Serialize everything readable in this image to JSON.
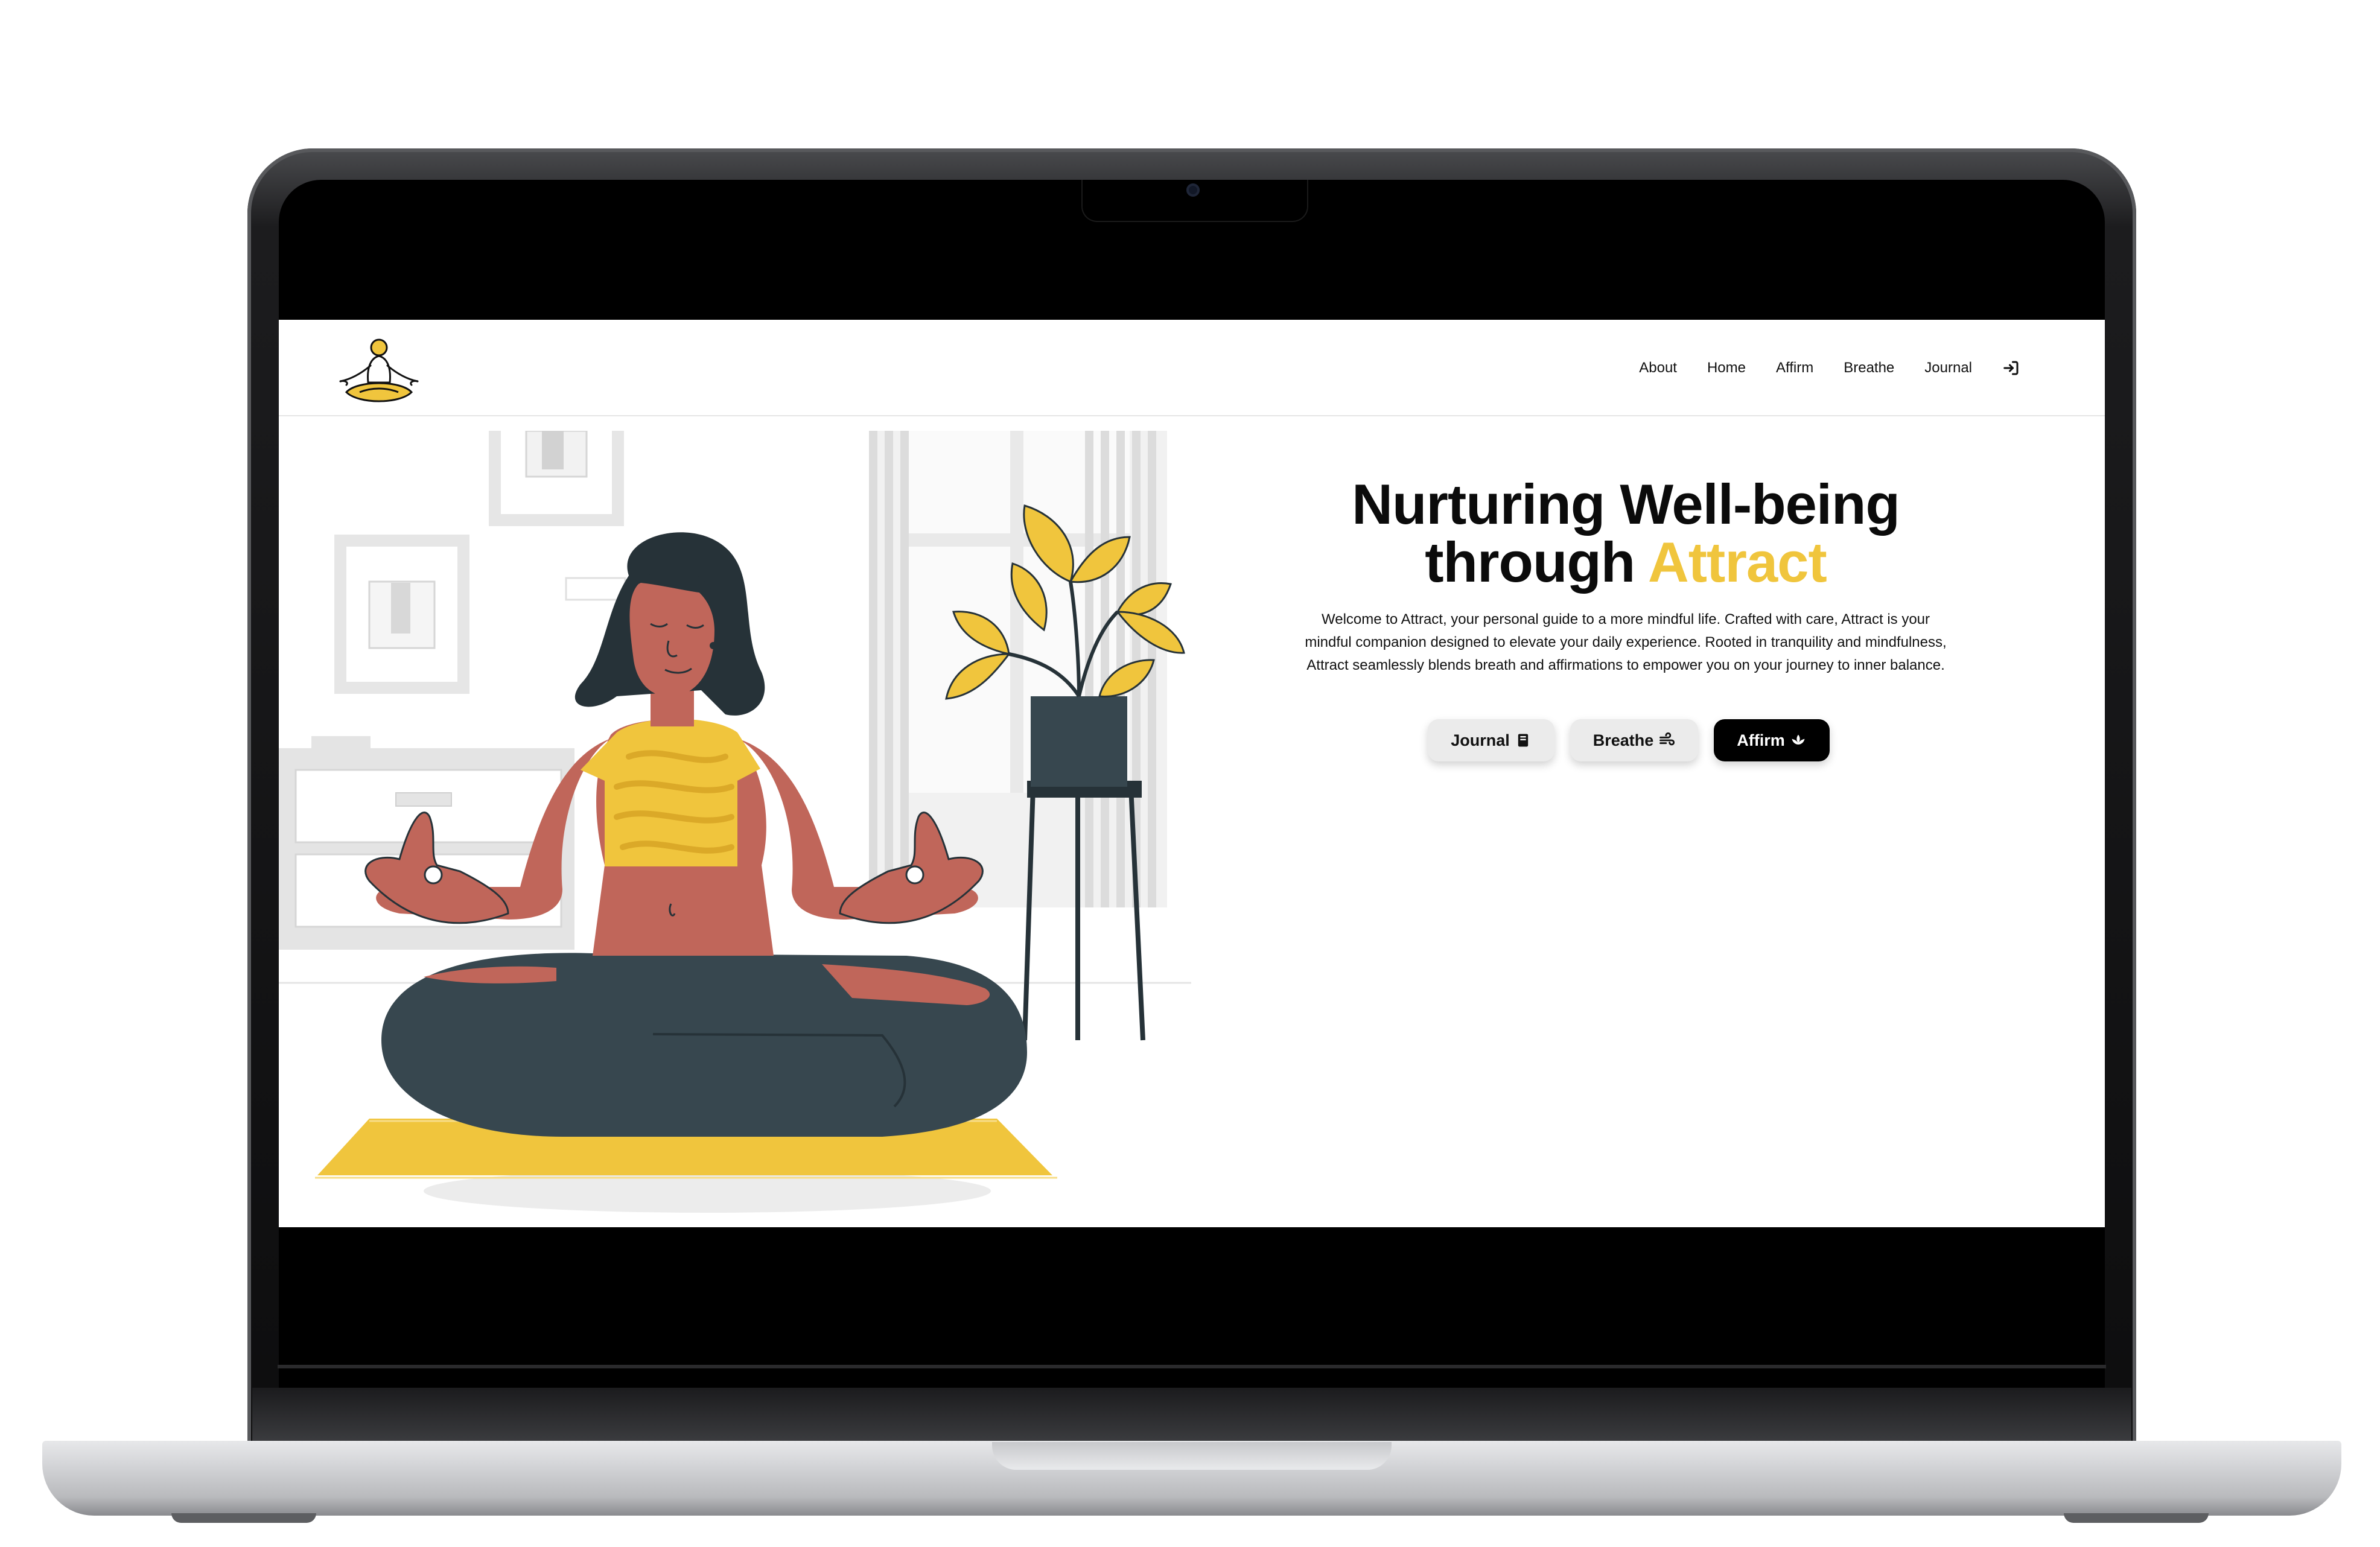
{
  "nav": {
    "links": [
      "About",
      "Home",
      "Affirm",
      "Breathe",
      "Journal"
    ],
    "login_icon": "login-arrow-icon",
    "logo_icon": "meditation-logo-icon"
  },
  "hero": {
    "title_line1": "Nurturing Well-being",
    "title_line2_prefix": "through ",
    "title_accent": "Attract",
    "description": "Welcome to Attract, your personal guide to a more mindful life. Crafted with care, Attract is your mindful companion designed to elevate your daily experience. Rooted in tranquility and mindfulness, Attract seamlessly blends breath and affirmations to empower you on your journey to inner balance.",
    "buttons": [
      {
        "label": "Journal",
        "icon": "notebook-icon",
        "style": "light"
      },
      {
        "label": "Breathe",
        "icon": "wind-icon",
        "style": "light"
      },
      {
        "label": "Affirm",
        "icon": "lotus-icon",
        "style": "dark"
      }
    ]
  },
  "colors": {
    "accent": "#f0c53d",
    "text": "#0b0b0b",
    "dark_button": "#000000",
    "light_button": "#ebebeb"
  }
}
